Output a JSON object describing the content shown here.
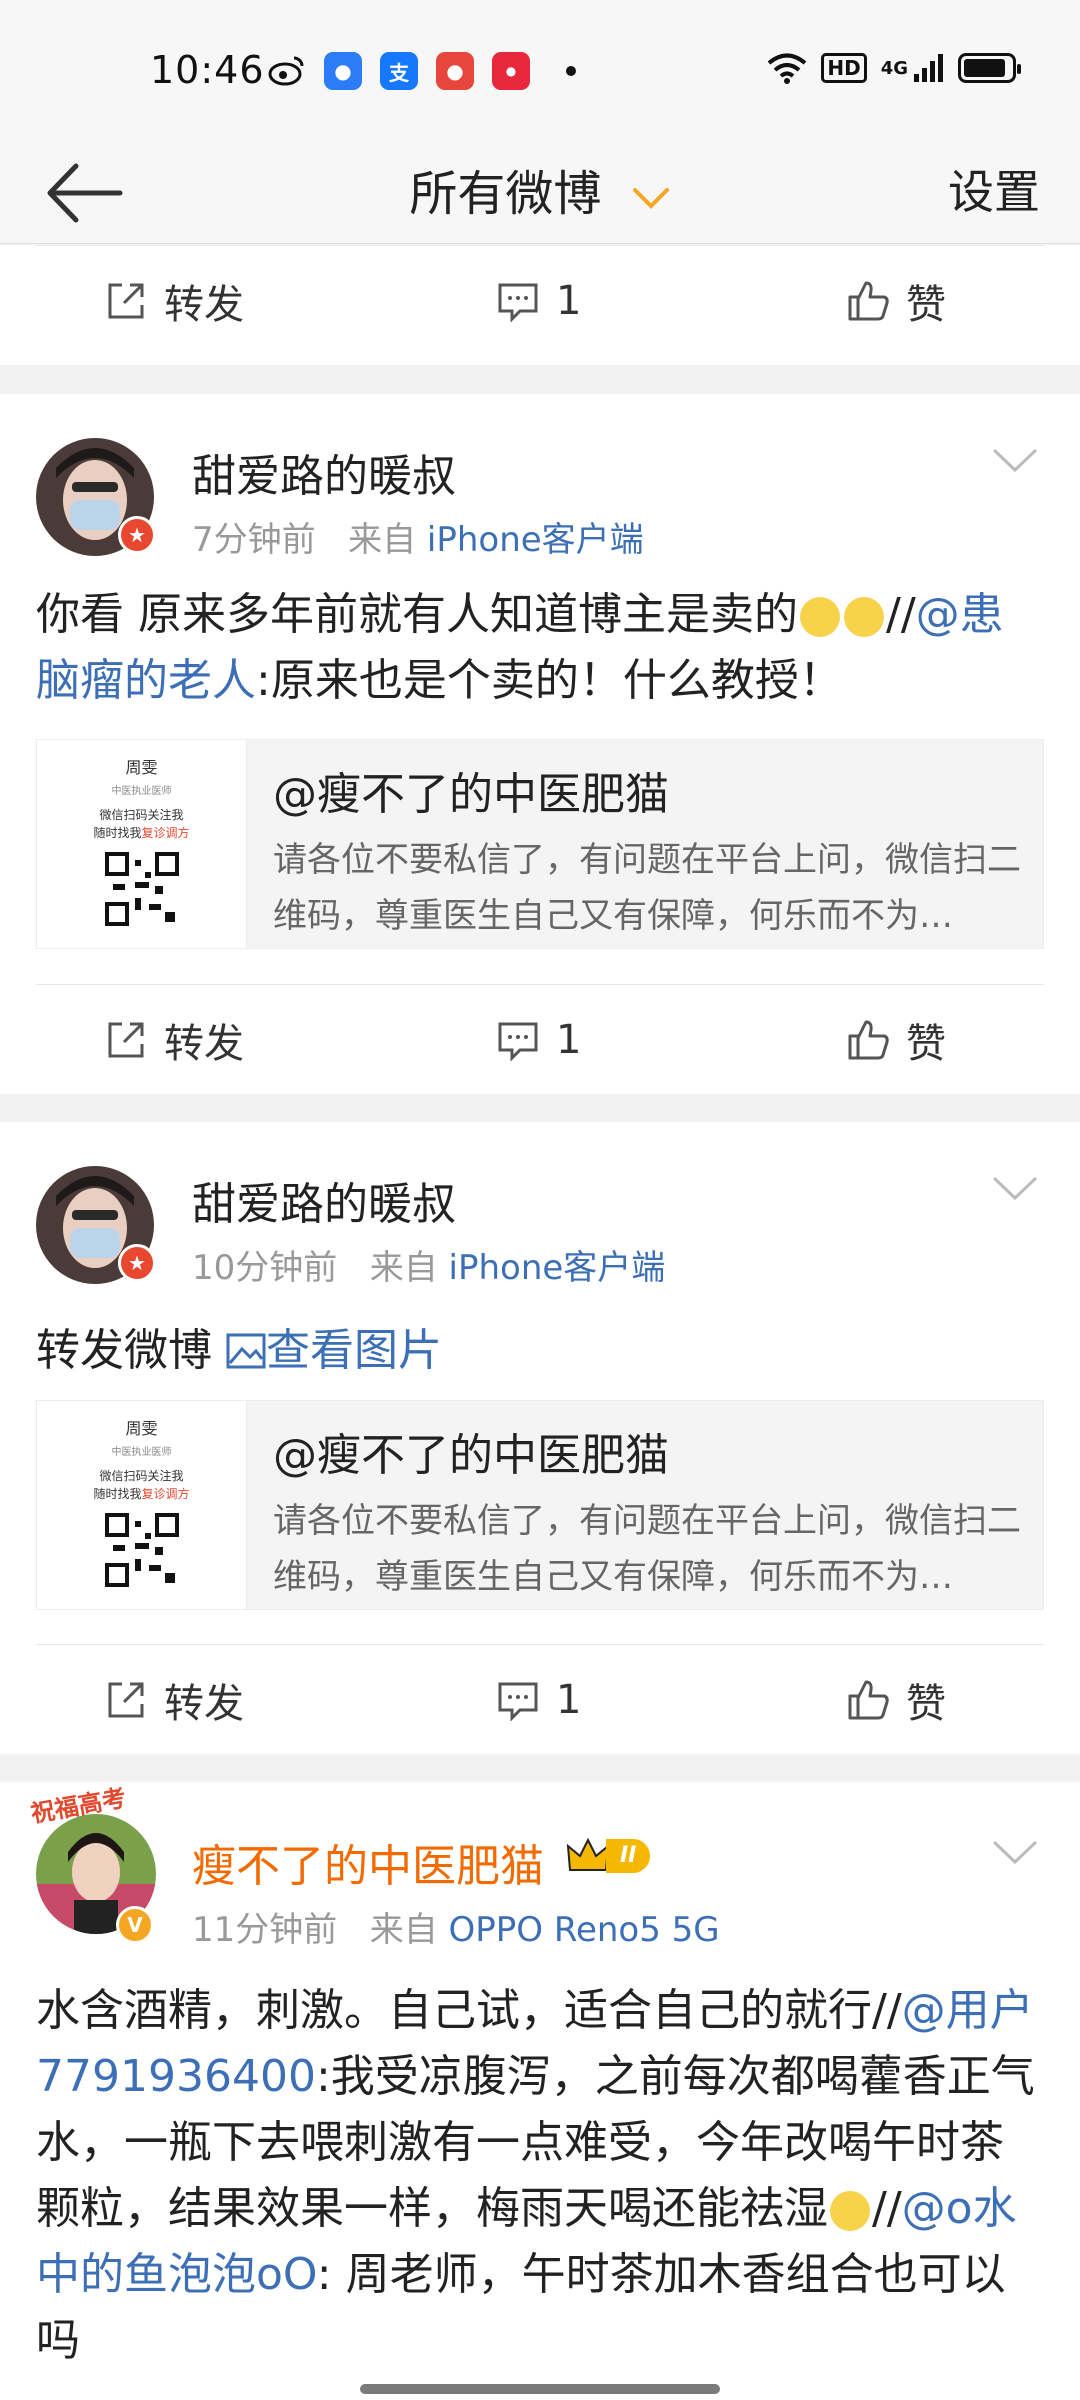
{
  "status_bar": {
    "time": "10:46",
    "left_icons": [
      "weibo-icon",
      "app-icon-blue",
      "alipay-icon",
      "app-icon-red",
      "app-icon-red2"
    ],
    "right_icons": [
      "wifi-icon",
      "hd-icon",
      "signal-4g-icon",
      "battery-icon"
    ],
    "network_label": "4G",
    "hd_label": "HD"
  },
  "nav": {
    "title": "所有微博",
    "settings_label": "设置",
    "back_icon": "arrow-left-icon",
    "dropdown_icon": "chevron-down-icon"
  },
  "actions": {
    "repost_label": "转发",
    "like_label": "赞"
  },
  "posts": [
    {
      "comment_count": "1"
    },
    {
      "username": "甜爱路的暖叔",
      "time": "7分钟前",
      "source_prefix": "来自",
      "source": "iPhone客户端",
      "text_part1": "你看 原来多年前就有人知道博主是卖的",
      "text_sep": "//",
      "mention": "@患脑瘤的老人",
      "text_part2": ":原来也是个卖的！什么教授！",
      "embed_title": "@瘦不了的中医肥猫",
      "embed_desc": "请各位不要私信了，有问题在平台上问，微信扫二维码，尊重医生自己又有保障，何乐而不为…",
      "thumb_name": "周雯",
      "thumb_subtitle": "中医执业医师",
      "thumb_line1": "微信扫码关注我",
      "thumb_line2a": "随时找我",
      "thumb_line2b": "复诊调方",
      "comment_count": "1"
    },
    {
      "username": "甜爱路的暖叔",
      "time": "10分钟前",
      "source_prefix": "来自",
      "source": "iPhone客户端",
      "text": "转发微博",
      "view_image": "查看图片",
      "embed_title": "@瘦不了的中医肥猫",
      "embed_desc": "请各位不要私信了，有问题在平台上问，微信扫二维码，尊重医生自己又有保障，何乐而不为…",
      "thumb_name": "周雯",
      "thumb_subtitle": "中医执业医师",
      "thumb_line1": "微信扫码关注我",
      "thumb_line2a": "随时找我",
      "thumb_line2b": "复诊调方",
      "comment_count": "1"
    },
    {
      "username": "瘦不了的中医肥猫",
      "avatar_banner": "祝福高考",
      "vip_level": "II",
      "time": "11分钟前",
      "source_prefix": "来自",
      "source": "OPPO Reno5 5G",
      "t1": "水含酒精，刺激。自己试，适合自己的就行//",
      "m1": "@用户7791936400",
      "t2": ":我受凉腹泻，之前每次都喝藿香正气水，一瓶下去喂刺激有一点难受，今年改喝午时茶颗粒，结果效果一样，梅雨天喝还能祛湿",
      "t3": "//",
      "m2": "@o水中的鱼泡泡oO",
      "t4": ": 周老师，午时茶加木香组合也可以吗"
    }
  ],
  "colors": {
    "link": "#3d6fb6",
    "vip_name": "#f26a00",
    "accent": "#f5a623"
  }
}
